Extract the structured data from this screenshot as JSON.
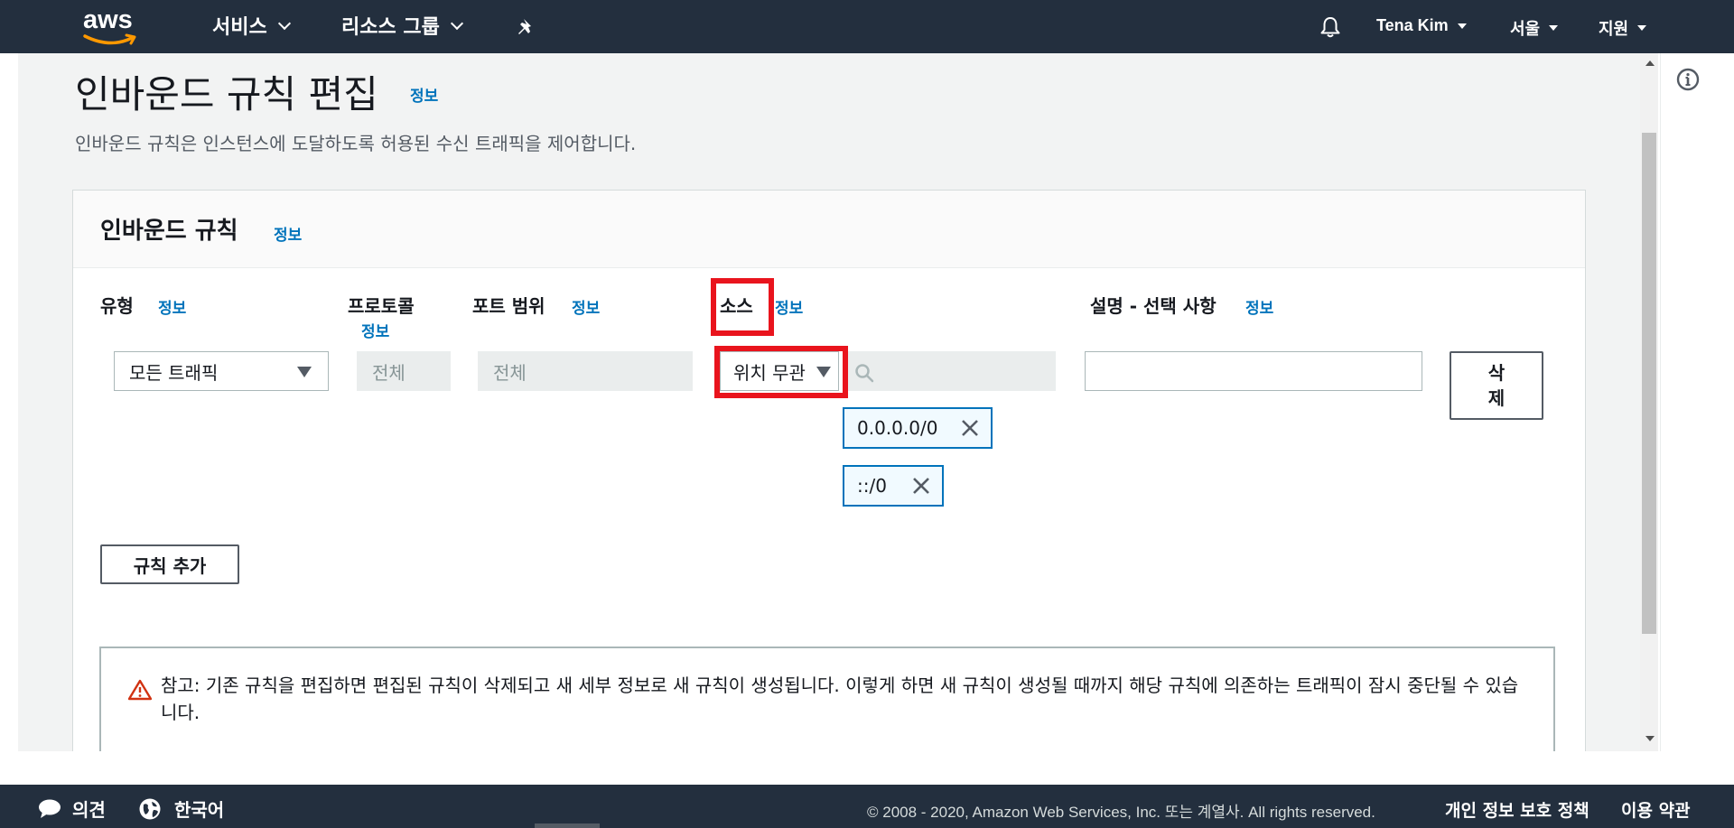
{
  "topnav": {
    "logo_text": "aws",
    "services_label": "서비스",
    "resource_groups_label": "리소스 그룹",
    "user_label": "Tena Kim",
    "region_label": "서울",
    "support_label": "지원"
  },
  "page": {
    "title": "인바운드 규칙 편집",
    "title_info": "정보",
    "description": "인바운드 규칙은 인스턴스에 도달하도록 허용된 수신 트래픽을 제어합니다."
  },
  "card": {
    "title": "인바운드 규칙",
    "title_info": "정보",
    "columns": {
      "type": {
        "label": "유형",
        "info": "정보"
      },
      "protocol": {
        "label": "프로토콜",
        "info": "정보"
      },
      "port_range": {
        "label": "포트 범위",
        "info": "정보"
      },
      "source": {
        "label": "소스",
        "info": "정보"
      },
      "description": {
        "label": "설명 - 선택 사항",
        "info": "정보"
      }
    },
    "rule": {
      "type_value": "모든 트래픽",
      "protocol_value": "전체",
      "port_value": "전체",
      "source_value": "위치 무관",
      "search_placeholder": "",
      "description_value": "",
      "delete_label": "삭제",
      "tokens": [
        "0.0.0.0/0",
        "::/0"
      ]
    },
    "add_rule_label": "규칙 추가",
    "alert_text": "참고: 기존 규칙을 편집하면 편집된 규칙이 삭제되고 새 세부 정보로 새 규칙이 생성됩니다. 이렇게 하면 새 규칙이 생성될 때까지 해당 규칙에 의존하는 트래픽이 잠시 중단될 수 있습니다."
  },
  "footer": {
    "feedback_label": "의견",
    "language_label": "한국어",
    "copyright": "© 2008 - 2020, Amazon Web Services, Inc. 또는 계열사. All rights reserved.",
    "privacy_label": "개인 정보 보호 정책",
    "terms_label": "이용 약관"
  },
  "colors": {
    "nav_bg": "#232f3e",
    "link": "#0073bb",
    "highlight": "#e9141d",
    "warning": "#d13212"
  }
}
